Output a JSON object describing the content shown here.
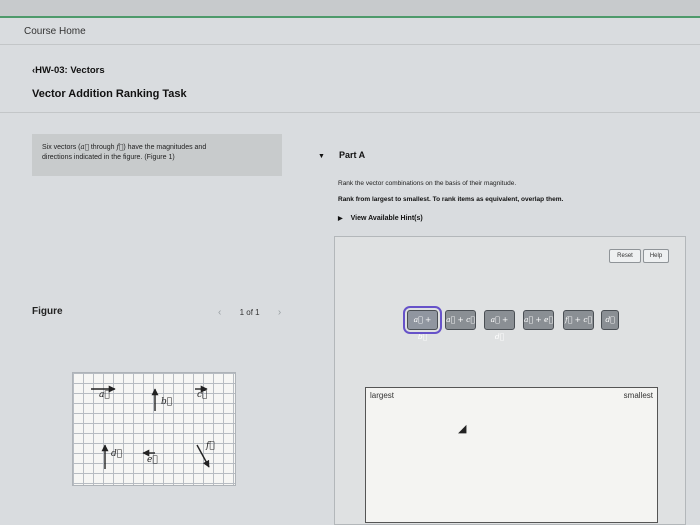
{
  "course_home": "Course Home",
  "breadcrumb": "‹HW-03: Vectors",
  "page_title": "Vector Addition Ranking Task",
  "intro": {
    "text_1": "Six vectors (",
    "vec_a": "a⃗",
    "text_2": " through ",
    "vec_f": "f⃗",
    "text_3": ") have the magnitudes and",
    "line_2": "directions indicated in the figure. (Figure 1)"
  },
  "figure": {
    "title": "Figure",
    "prev_icon": "‹",
    "page_indicator": "1 of 1",
    "next_icon": "›",
    "vector_labels": [
      "a⃗",
      "b⃗",
      "c⃗",
      "d⃗",
      "e⃗",
      "f⃗"
    ]
  },
  "part": {
    "caret": "▼",
    "title": "Part A",
    "instruction": "Rank the vector combinations on the basis of their magnitude.",
    "instruction_bold": "Rank from largest to smallest. To rank items as equivalent, overlap them.",
    "hints_caret": "▶",
    "hints_label": "View Available Hint(s)"
  },
  "buttons": {
    "reset": "Reset",
    "help": "Help"
  },
  "tiles": [
    "a⃗ + b⃗",
    "a⃗ + c⃗",
    "a⃗ + d⃗",
    "a⃗ + e⃗",
    "f⃗ + c⃗",
    "d⃗"
  ],
  "ranking": {
    "largest": "largest",
    "smallest": "smallest"
  },
  "colors": {
    "accent_bar": "#4e9a6b",
    "tile_selected": "#6652c9"
  }
}
